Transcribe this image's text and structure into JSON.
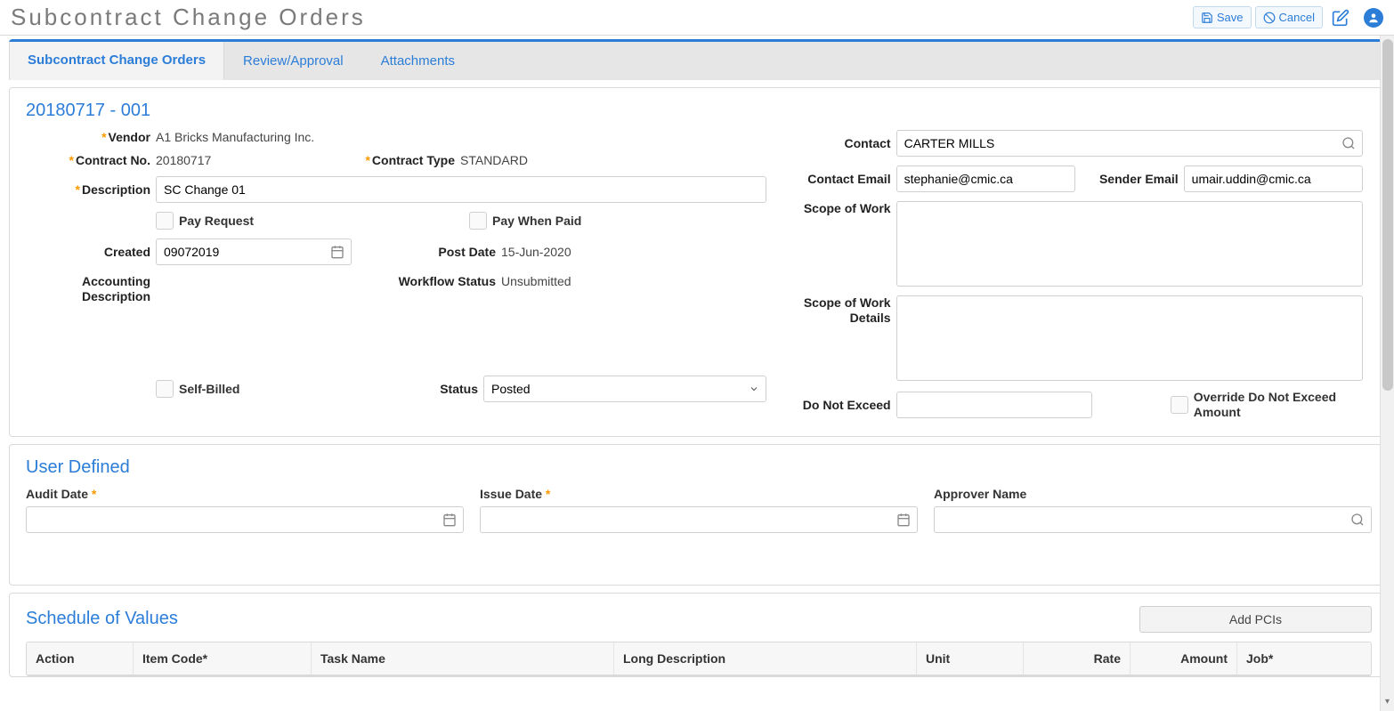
{
  "app_title": "Subcontract Change Orders",
  "header": {
    "save_label": "Save",
    "cancel_label": "Cancel"
  },
  "tabs": [
    {
      "label": "Subcontract Change Orders"
    },
    {
      "label": "Review/Approval"
    },
    {
      "label": "Attachments"
    }
  ],
  "record": {
    "title": "20180717 - 001",
    "vendor_label": "Vendor",
    "vendor": "A1 Bricks Manufacturing Inc.",
    "contract_no_label": "Contract No.",
    "contract_no": "20180717",
    "contract_type_label": "Contract Type",
    "contract_type": "STANDARD",
    "description_label": "Description",
    "description": "SC Change 01",
    "pay_request_label": "Pay Request",
    "pay_when_paid_label": "Pay When Paid",
    "created_label": "Created",
    "created": "09072019",
    "post_date_label": "Post Date",
    "post_date": "15-Jun-2020",
    "accounting_desc_label": "Accounting Description",
    "workflow_status_label": "Workflow Status",
    "workflow_status": "Unsubmitted",
    "self_billed_label": "Self-Billed",
    "status_label": "Status",
    "status": "Posted",
    "contact_label": "Contact",
    "contact": "CARTER MILLS",
    "contact_email_label": "Contact Email",
    "contact_email": "stephanie@cmic.ca",
    "sender_email_label": "Sender Email",
    "sender_email": "umair.uddin@cmic.ca",
    "scope_of_work_label": "Scope of Work",
    "scope_of_work": "",
    "scope_details_label": "Scope of Work Details",
    "scope_details": "",
    "do_not_exceed_label": "Do Not Exceed",
    "do_not_exceed": "",
    "override_label": "Override Do Not Exceed Amount"
  },
  "user_defined": {
    "title": "User Defined",
    "audit_date_label": "Audit Date",
    "issue_date_label": "Issue Date",
    "approver_name_label": "Approver Name"
  },
  "sov": {
    "title": "Schedule of Values",
    "add_pcis_label": "Add PCIs",
    "cols": {
      "action": "Action",
      "item_code": "Item Code*",
      "task_name": "Task Name",
      "long_desc": "Long Description",
      "unit": "Unit",
      "rate": "Rate",
      "amount": "Amount",
      "job": "Job*"
    }
  }
}
